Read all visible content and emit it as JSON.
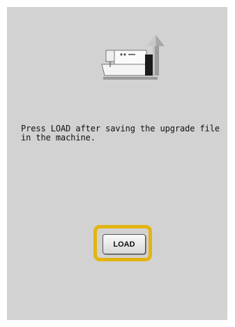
{
  "screen": {
    "icon": "sewing-machine-upgrade-icon",
    "message": "Press LOAD after saving the upgrade file\nin the machine."
  },
  "load_button": {
    "label": "LOAD",
    "highlight_color": "#e2b410"
  }
}
